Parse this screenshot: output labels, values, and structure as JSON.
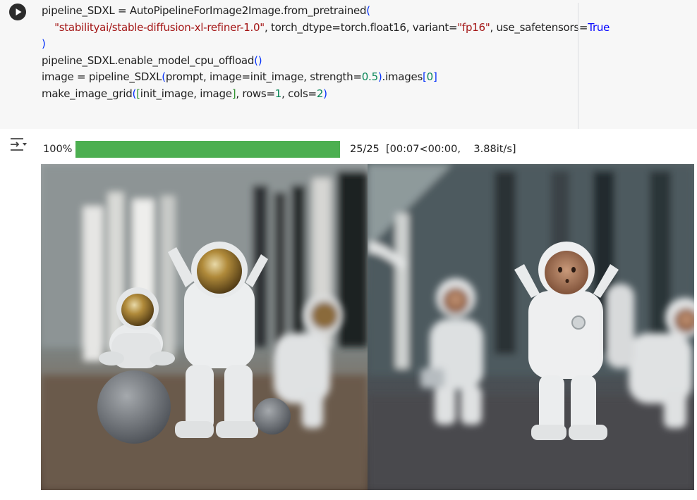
{
  "code_cell": {
    "lines": [
      {
        "segments": [
          {
            "t": "pipeline_SDXL = AutoPipelineForImage2Image.from_pretrained"
          },
          {
            "t": "(",
            "c": "br1"
          }
        ]
      },
      {
        "segments": [
          {
            "t": "    "
          },
          {
            "t": "\"stabilityai/stable-diffusion-xl-refiner-1.0\"",
            "c": "str"
          },
          {
            "t": ", torch_dtype=torch.float16, variant="
          },
          {
            "t": "\"fp16\"",
            "c": "str"
          },
          {
            "t": ", use_safetensors="
          },
          {
            "t": "True",
            "c": "kw"
          }
        ]
      },
      {
        "segments": [
          {
            "t": ")",
            "c": "br1"
          }
        ]
      },
      {
        "segments": [
          {
            "t": "pipeline_SDXL.enable_model_cpu_offload"
          },
          {
            "t": "()",
            "c": "br1"
          }
        ]
      },
      {
        "segments": [
          {
            "t": "image = pipeline_SDXL"
          },
          {
            "t": "(",
            "c": "br1"
          },
          {
            "t": "prompt, image=init_image, strength="
          },
          {
            "t": "0.5",
            "c": "num"
          },
          {
            "t": ")",
            "c": "br1"
          },
          {
            "t": ".images"
          },
          {
            "t": "[",
            "c": "br1"
          },
          {
            "t": "0",
            "c": "num"
          },
          {
            "t": "]",
            "c": "br1"
          }
        ]
      },
      {
        "segments": [
          {
            "t": "make_image_grid"
          },
          {
            "t": "(",
            "c": "br1"
          },
          {
            "t": "[",
            "c": "br2"
          },
          {
            "t": "init_image, image"
          },
          {
            "t": "]",
            "c": "br2"
          },
          {
            "t": ", rows="
          },
          {
            "t": "1",
            "c": "num"
          },
          {
            "t": ", cols="
          },
          {
            "t": "2",
            "c": "num"
          },
          {
            "t": ")",
            "c": "br1"
          }
        ]
      }
    ]
  },
  "output": {
    "progress": {
      "percent_label": "100%",
      "fraction": 1.0,
      "stats": "25/25  [00:07<00:00,    3.88it/s]"
    },
    "images": [
      {
        "name": "init_image",
        "description_icon": "astronaut-figurines-gold-visor"
      },
      {
        "name": "refined_image",
        "description_icon": "astronaut-figurines-face"
      }
    ]
  },
  "colors": {
    "cell_bg": "#f7f7f7",
    "progress_fill": "#4caf50",
    "progress_track": "#e6e6e6",
    "string": "#a31515",
    "number": "#098658",
    "keyword": "#0000ff"
  }
}
